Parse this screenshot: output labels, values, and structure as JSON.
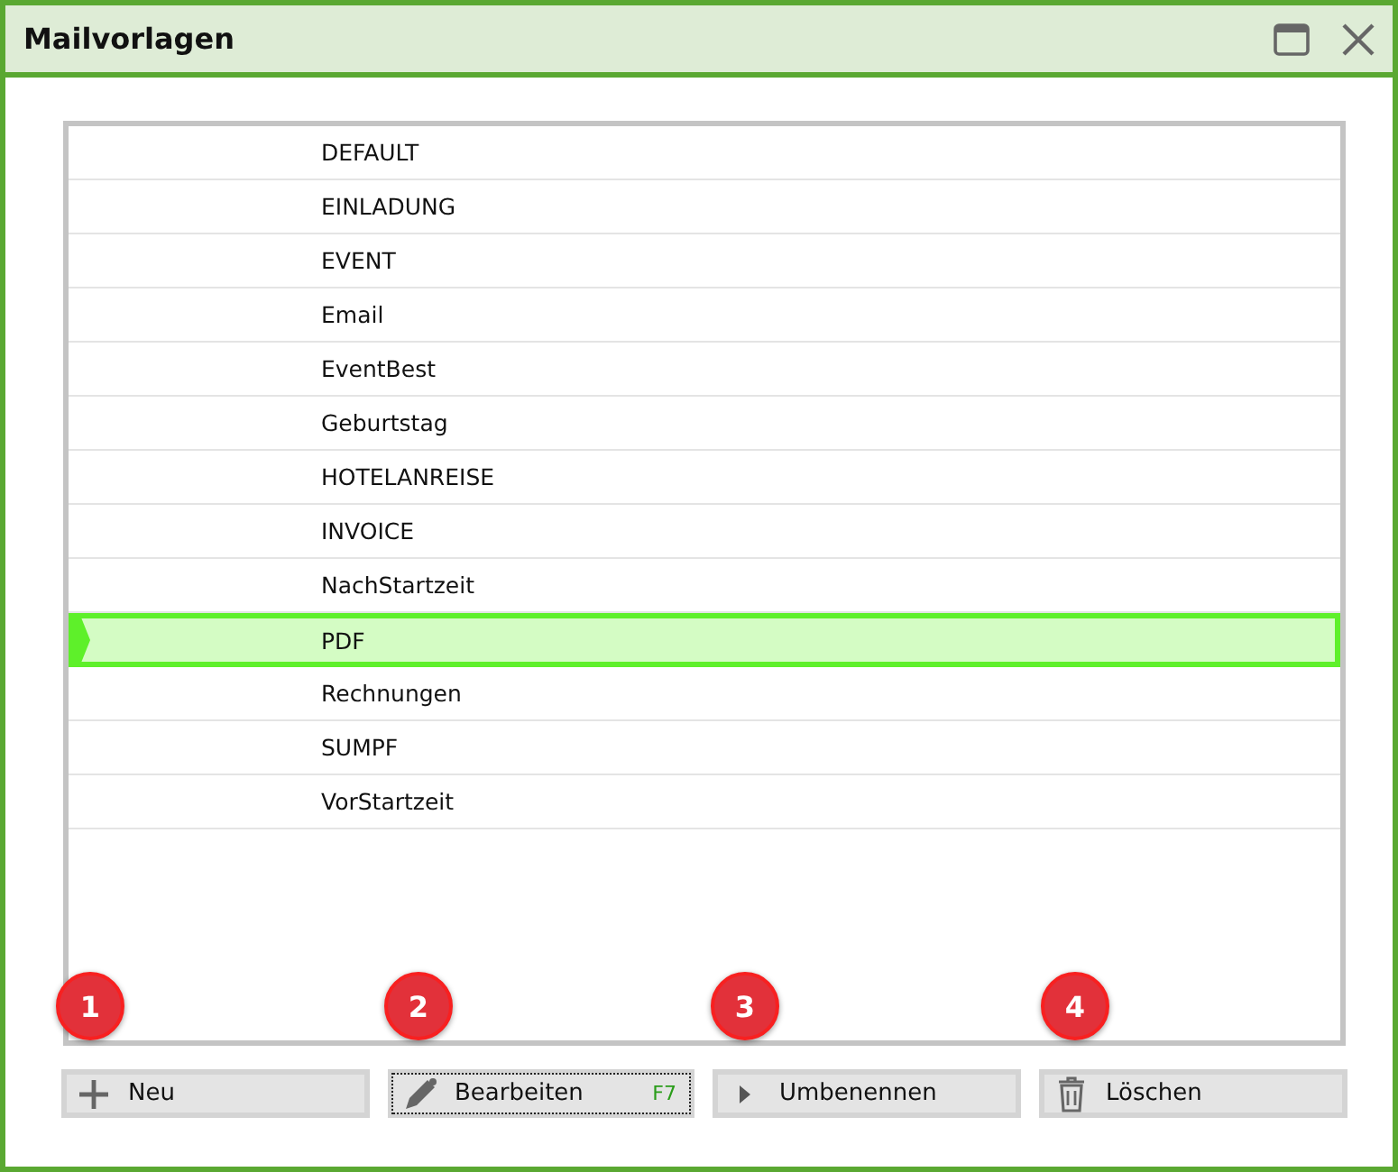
{
  "window": {
    "title": "Mailvorlagen"
  },
  "templates": [
    {
      "name": "DEFAULT",
      "selected": false
    },
    {
      "name": "EINLADUNG",
      "selected": false
    },
    {
      "name": "EVENT",
      "selected": false
    },
    {
      "name": "Email",
      "selected": false
    },
    {
      "name": "EventBest",
      "selected": false
    },
    {
      "name": "Geburtstag",
      "selected": false
    },
    {
      "name": "HOTELANREISE",
      "selected": false
    },
    {
      "name": "INVOICE",
      "selected": false
    },
    {
      "name": "NachStartzeit",
      "selected": false
    },
    {
      "name": "PDF",
      "selected": true
    },
    {
      "name": "Rechnungen",
      "selected": false
    },
    {
      "name": "SUMPF",
      "selected": false
    },
    {
      "name": "VorStartzeit",
      "selected": false
    }
  ],
  "buttons": [
    {
      "kind": "add",
      "label": "Neu",
      "badge": "1",
      "focused": false
    },
    {
      "kind": "edit",
      "label": "Bearbeiten",
      "shortcut": "F7",
      "badge": "2",
      "focused": true
    },
    {
      "kind": "rename",
      "label": "Umbenennen",
      "badge": "3",
      "focused": false
    },
    {
      "kind": "delete",
      "label": "Löschen",
      "badge": "4",
      "focused": false
    }
  ]
}
